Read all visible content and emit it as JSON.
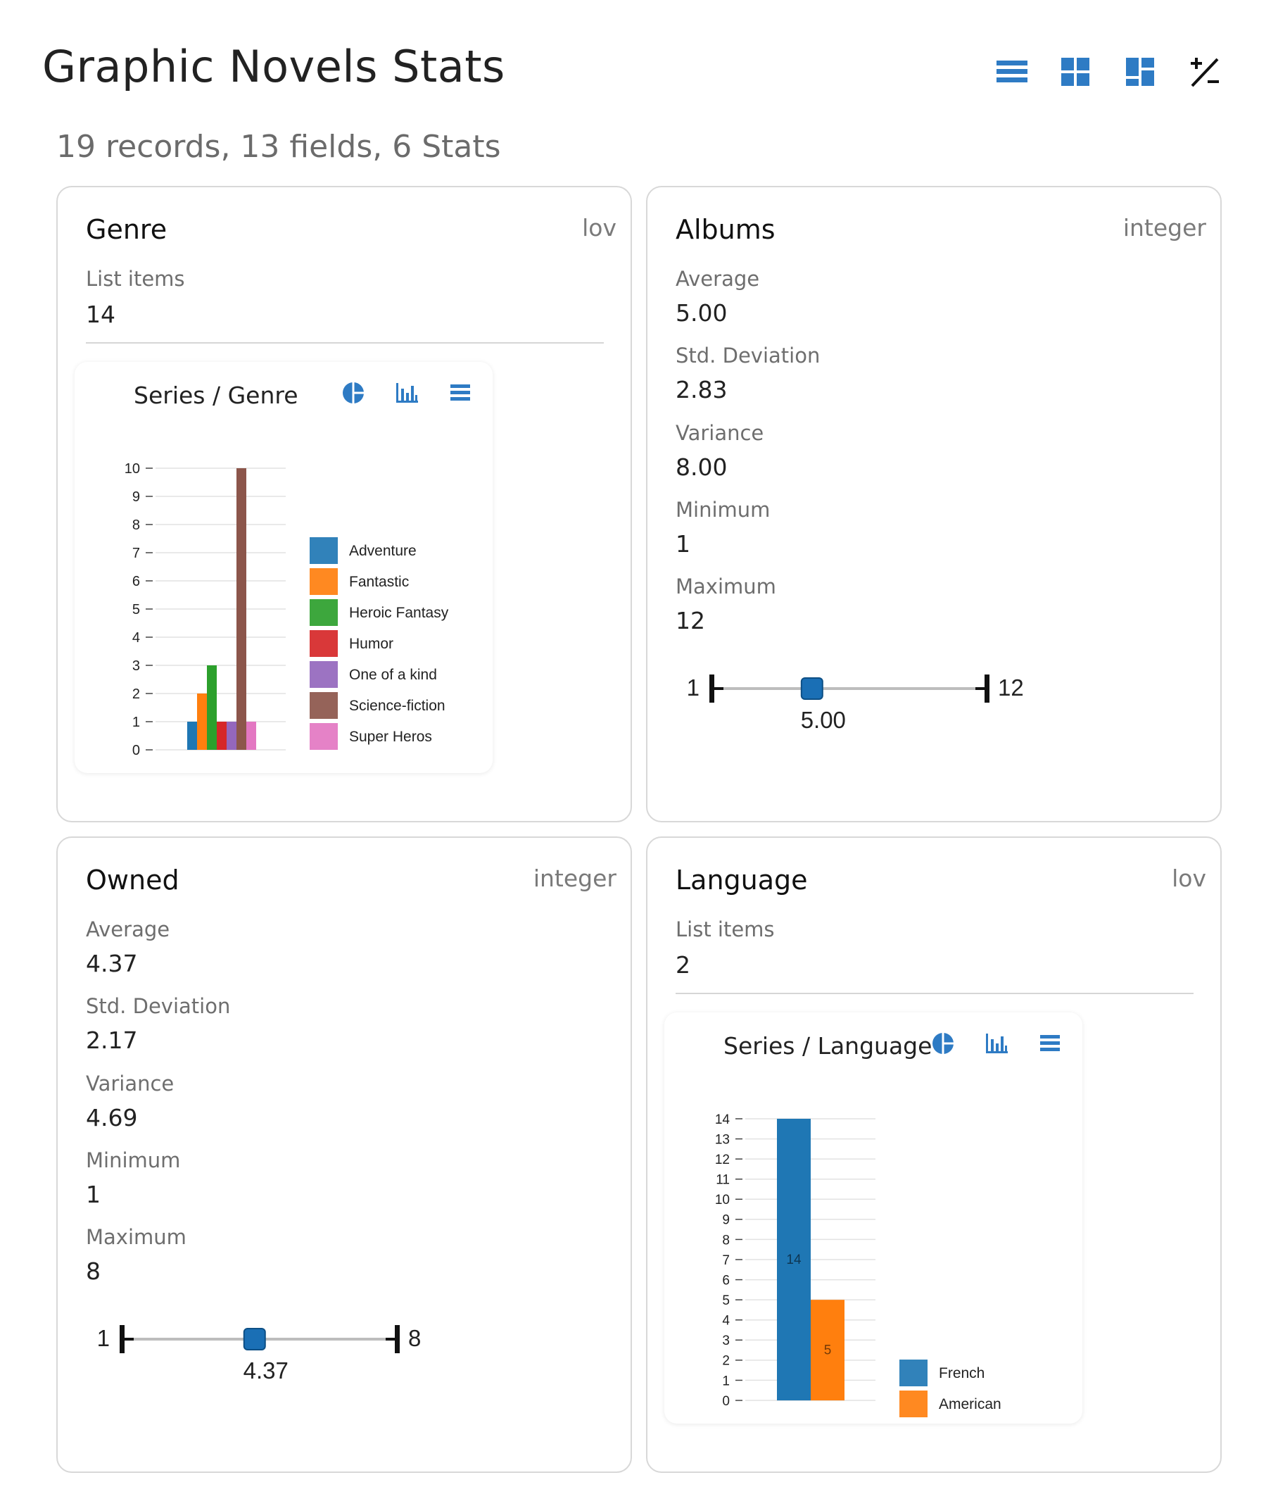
{
  "page": {
    "title": "Graphic Novels Stats",
    "summary": "19 records, 13 fields, 6 Stats"
  },
  "toolbar": {
    "icons": [
      "list-view-icon",
      "grid-view-icon",
      "dashboard-view-icon",
      "plus-minus-icon"
    ],
    "accent": "#2e7bc4"
  },
  "cards": {
    "genre": {
      "title": "Genre",
      "type": "lov",
      "list_items_label": "List items",
      "list_items_value": "14",
      "chart_title": "Series / Genre"
    },
    "albums": {
      "title": "Albums",
      "type": "integer",
      "stats": [
        {
          "label": "Average",
          "value": "5.00"
        },
        {
          "label": "Std. Deviation",
          "value": "2.83"
        },
        {
          "label": "Variance",
          "value": "8.00"
        },
        {
          "label": "Minimum",
          "value": "1"
        },
        {
          "label": "Maximum",
          "value": "12"
        }
      ],
      "range": {
        "min_label": "1",
        "max_label": "12",
        "avg_label": "5.00",
        "min": 1,
        "max": 12,
        "avg": 5.0
      }
    },
    "owned": {
      "title": "Owned",
      "type": "integer",
      "stats": [
        {
          "label": "Average",
          "value": "4.37"
        },
        {
          "label": "Std. Deviation",
          "value": "2.17"
        },
        {
          "label": "Variance",
          "value": "4.69"
        },
        {
          "label": "Minimum",
          "value": "1"
        },
        {
          "label": "Maximum",
          "value": "8"
        }
      ],
      "range": {
        "min_label": "1",
        "max_label": "8",
        "avg_label": "4.37",
        "min": 1,
        "max": 8,
        "avg": 4.37
      }
    },
    "language": {
      "title": "Language",
      "type": "lov",
      "list_items_label": "List items",
      "list_items_value": "2",
      "chart_title": "Series / Language"
    }
  },
  "chart_data": [
    {
      "type": "bar",
      "title": "Series / Genre",
      "ylim": [
        0,
        10
      ],
      "yticks": [
        "0",
        "1",
        "2",
        "3",
        "4",
        "5",
        "6",
        "7",
        "8",
        "9",
        "10"
      ],
      "grid": true,
      "legend_position": "right",
      "data_labels": false,
      "series": [
        {
          "name": "Adventure",
          "value": 1,
          "color": "#1f77b4"
        },
        {
          "name": "Fantastic",
          "value": 2,
          "color": "#ff7f0e"
        },
        {
          "name": "Heroic Fantasy",
          "value": 3,
          "color": "#2ca02c"
        },
        {
          "name": "Humor",
          "value": 1,
          "color": "#d62728"
        },
        {
          "name": "One of a kind",
          "value": 1,
          "color": "#9467bd"
        },
        {
          "name": "Science-fiction",
          "value": 10,
          "color": "#8c564b"
        },
        {
          "name": "Super Heros",
          "value": 1,
          "color": "#e377c2"
        }
      ]
    },
    {
      "type": "bar",
      "title": "Series / Language",
      "ylim": [
        0,
        14
      ],
      "yticks": [
        "0",
        "1",
        "2",
        "3",
        "4",
        "5",
        "6",
        "7",
        "8",
        "9",
        "10",
        "11",
        "12",
        "13",
        "14"
      ],
      "grid": true,
      "legend_position": "right",
      "data_labels": true,
      "series": [
        {
          "name": "French",
          "value": 14,
          "color": "#1f77b4"
        },
        {
          "name": "American",
          "value": 5,
          "color": "#ff7f0e"
        }
      ]
    }
  ]
}
